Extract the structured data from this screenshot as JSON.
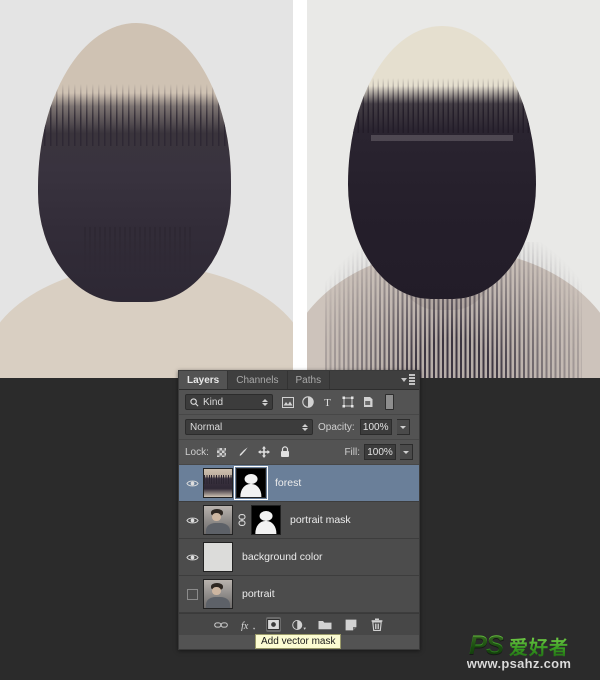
{
  "canvas": {
    "left_image_alt": "double exposure portrait with forest, light sepia",
    "right_image_alt": "double exposure portrait with forest, dark variant"
  },
  "panel": {
    "tabs": [
      {
        "label": "Layers",
        "active": true
      },
      {
        "label": "Channels",
        "active": false
      },
      {
        "label": "Paths",
        "active": false
      }
    ],
    "menu_icon": "panel-menu-icon",
    "filter": {
      "search_icon": "search-icon",
      "kind_label": "Kind",
      "icons": [
        "pixel-layer-filter-icon",
        "adjustment-layer-filter-icon",
        "type-layer-filter-icon",
        "shape-layer-filter-icon",
        "smart-object-filter-icon"
      ],
      "toggle_icon": "filter-toggle-switch"
    },
    "blend": {
      "mode": "Normal",
      "opacity_label": "Opacity:",
      "opacity_value": "100%"
    },
    "lock": {
      "label": "Lock:",
      "icons": [
        "lock-transparent-pixels-icon",
        "lock-image-pixels-icon",
        "lock-position-icon",
        "lock-all-icon"
      ],
      "fill_label": "Fill:",
      "fill_value": "100%"
    },
    "layers": [
      {
        "name": "forest",
        "visible": true,
        "selected": true,
        "thumb": "forest",
        "has_mask": true,
        "mask_active": true,
        "linked": false
      },
      {
        "name": "portrait mask",
        "visible": true,
        "selected": false,
        "thumb": "portrait",
        "has_mask": true,
        "mask_active": false,
        "linked": true
      },
      {
        "name": "background color",
        "visible": true,
        "selected": false,
        "thumb": "solid",
        "has_mask": false,
        "mask_active": false,
        "linked": false
      },
      {
        "name": "portrait",
        "visible": false,
        "selected": false,
        "thumb": "portrait",
        "has_mask": false,
        "mask_active": false,
        "linked": false
      }
    ],
    "toolbar": {
      "icons": [
        "link-layers-icon",
        "layer-style-fx-icon",
        "add-layer-mask-icon",
        "new-adjustment-layer-icon",
        "new-group-icon",
        "new-layer-icon",
        "delete-layer-icon"
      ],
      "active_icon": "add-layer-mask-icon"
    },
    "tooltip": "Add vector mask"
  },
  "watermark": {
    "logo": "PS",
    "chinese": "爱好者",
    "url": "www.psahz.com",
    "accent_color": "#2f8d1e"
  }
}
